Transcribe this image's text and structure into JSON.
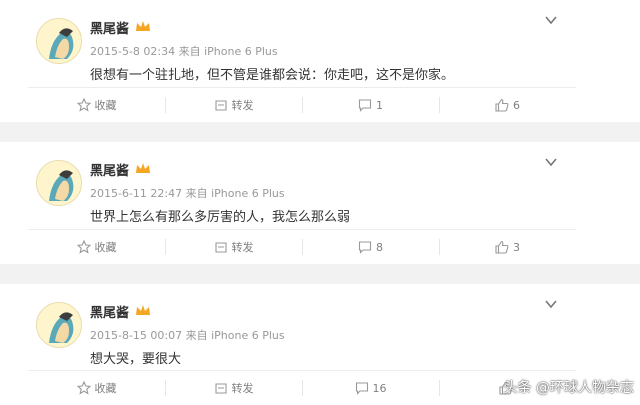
{
  "posts": [
    {
      "user": "黑尾酱",
      "meta": "2015-5-8 02:34 来自 iPhone 6 Plus",
      "text": "很想有一个驻扎地，但不管是谁都会说：你走吧，这不是你家。",
      "actions": {
        "favorite": "收藏",
        "repost": "转发",
        "comments": "1",
        "likes": "6"
      }
    },
    {
      "user": "黑尾酱",
      "meta": "2015-6-11 22:47 来自 iPhone 6 Plus",
      "text": "世界上怎么有那么多厉害的人，我怎么那么弱",
      "actions": {
        "favorite": "收藏",
        "repost": "转发",
        "comments": "8",
        "likes": "3"
      }
    },
    {
      "user": "黑尾酱",
      "meta": "2015-8-15 00:07 来自 iPhone 6 Plus",
      "text": "想大哭，要很大",
      "actions": {
        "favorite": "收藏",
        "repost": "转发",
        "comments": "16",
        "likes": ""
      }
    }
  ],
  "watermark": "头条 @环球人物杂志",
  "icons": [
    "star-icon",
    "repost-icon",
    "comment-icon",
    "thumbs-up-icon",
    "chevron-down-icon",
    "vip-crown-icon"
  ],
  "colors": {
    "meta_gray": "#999999",
    "text": "#333333",
    "vip_orange": "#f5a623"
  }
}
